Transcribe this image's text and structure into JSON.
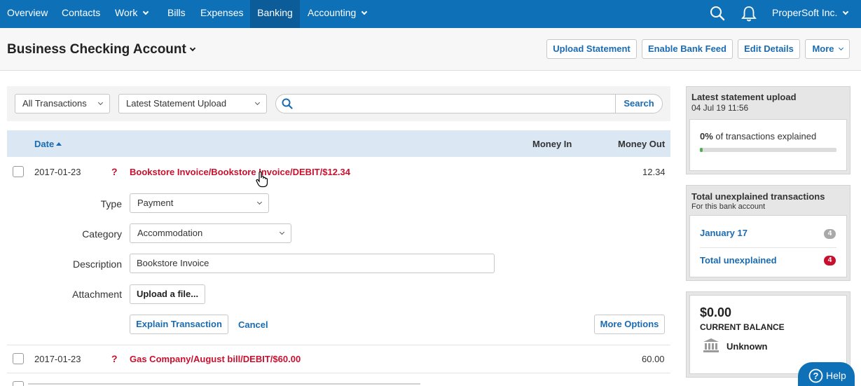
{
  "nav": {
    "items": [
      {
        "label": "Overview"
      },
      {
        "label": "Contacts"
      },
      {
        "label": "Work"
      },
      {
        "label": "Bills"
      },
      {
        "label": "Expenses"
      },
      {
        "label": "Banking"
      },
      {
        "label": "Accounting"
      }
    ],
    "company": "ProperSoft Inc."
  },
  "header": {
    "title": "Business Checking Account",
    "buttons": {
      "upload": "Upload Statement",
      "bank_feed": "Enable Bank Feed",
      "edit": "Edit Details",
      "more": "More"
    }
  },
  "filters": {
    "transactions": "All Transactions",
    "statement": "Latest Statement Upload",
    "search_placeholder": "",
    "search_button": "Search"
  },
  "table": {
    "col_date": "Date",
    "col_in": "Money In",
    "col_out": "Money Out",
    "rows": [
      {
        "date": "2017-01-23",
        "flag": "?",
        "description": "Bookstore Invoice/Bookstore Invoice/DEBIT/$12.34",
        "out": "12.34"
      },
      {
        "date": "2017-01-23",
        "flag": "?",
        "description": "Gas Company/August bill/DEBIT/$60.00",
        "out": "60.00"
      }
    ]
  },
  "explain_form": {
    "type_label": "Type",
    "type_value": "Payment",
    "category_label": "Category",
    "category_value": "Accommodation",
    "description_label": "Description",
    "description_value": "Bookstore Invoice",
    "attachment_label": "Attachment",
    "upload_button": "Upload a file...",
    "explain_button": "Explain Transaction",
    "cancel_link": "Cancel",
    "more_options": "More Options"
  },
  "sidebar": {
    "upload_title": "Latest statement upload",
    "upload_date": "04 Jul 19 11:56",
    "explained_pct": "0%",
    "explained_text": "of transactions explained",
    "explained_progress": 0.02,
    "unexplained_title": "Total unexplained transactions",
    "unexplained_sub": "For this bank account",
    "month_label": "January 17",
    "month_count": "4",
    "total_label": "Total unexplained",
    "total_count": "4",
    "balance": "$0.00",
    "balance_label": "CURRENT BALANCE",
    "bank_status": "Unknown"
  },
  "help": {
    "label": "Help"
  },
  "colors": {
    "brand": "#0e71b8",
    "link": "#1a6bb1",
    "alert": "#c8102e"
  }
}
